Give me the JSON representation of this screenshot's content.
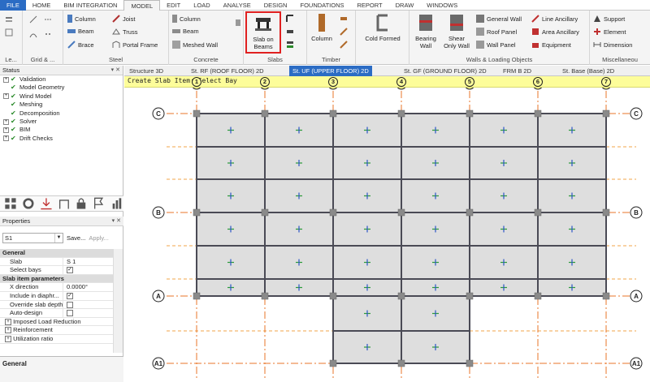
{
  "menu": {
    "tabs": [
      {
        "label": "FILE"
      },
      {
        "label": "HOME"
      },
      {
        "label": "BIM INTEGRATION"
      },
      {
        "label": "MODEL"
      },
      {
        "label": "EDIT"
      },
      {
        "label": "LOAD"
      },
      {
        "label": "ANALYSE"
      },
      {
        "label": "DESIGN"
      },
      {
        "label": "FOUNDATIONS"
      },
      {
        "label": "REPORT"
      },
      {
        "label": "DRAW"
      },
      {
        "label": "WINDOWS"
      }
    ]
  },
  "ribbon": {
    "groups": {
      "levels": "Le...",
      "grid": "Grid & ...",
      "steel": "Steel",
      "concrete": "Concrete",
      "slabs": "Slabs",
      "timber": "Timber",
      "walls": "Walls & Loading Objects",
      "misc": "Miscellaneou"
    },
    "steel": {
      "column": "Column",
      "beam": "Beam",
      "brace": "Brace",
      "joist": "Joist",
      "truss": "Truss",
      "portal_frame": "Portal Frame"
    },
    "concrete": {
      "column": "Column",
      "beam": "Beam",
      "meshed_wall": "Meshed Wall"
    },
    "slabs": {
      "slab_on_beams_1": "Slab on",
      "slab_on_beams_2": "Beams"
    },
    "timber": {
      "column": "Column"
    },
    "cold_formed": "Cold Formed",
    "walls": {
      "bearing_1": "Bearing",
      "bearing_2": "Wall",
      "shear_1": "Shear",
      "shear_2": "Only Wall",
      "general_wall": "General Wall",
      "roof_panel": "Roof Panel",
      "wall_panel": "Wall Panel",
      "line_ancillary": "Line Ancillary",
      "area_ancillary": "Area Ancillary",
      "equipment": "Equipment"
    },
    "misc": {
      "support": "Support",
      "element": "Element",
      "dimension": "Dimension"
    }
  },
  "status": {
    "title": "Status",
    "items": [
      {
        "label": "Validation",
        "expandable": true
      },
      {
        "label": "Model Geometry",
        "expandable": false
      },
      {
        "label": "Wind Model",
        "expandable": true
      },
      {
        "label": "Meshing",
        "expandable": false
      },
      {
        "label": "Decomposition",
        "expandable": false
      },
      {
        "label": "Solver",
        "expandable": true
      },
      {
        "label": "BIM",
        "expandable": true
      },
      {
        "label": "Drift Checks",
        "expandable": true
      }
    ]
  },
  "properties": {
    "title": "Properties",
    "selected": "S1",
    "save_label": "Save...",
    "apply_label": "Apply...",
    "general_cat": "General",
    "slab_key": "Slab",
    "slab_val": "S 1",
    "select_bays_key": "Select bays",
    "slab_params_cat": "Slab item parameters",
    "x_direction_key": "X direction",
    "x_direction_val": "0.0000°",
    "include_key": "Include in diaphr...",
    "override_key": "Override slab depth",
    "auto_design_key": "Auto-design",
    "imposed_key": "Imposed Load Reduction",
    "reinforcement_key": "Reinforcement",
    "utilization_key": "Utilization ratio",
    "footer": "General"
  },
  "doc_tabs": [
    {
      "label": "Structure 3D"
    },
    {
      "label": "St. RF (ROOF FLOOR) 2D"
    },
    {
      "label": "St. UF (UPPER FLOOR) 2D"
    },
    {
      "label": "St. GF (GROUND FLOOR) 2D"
    },
    {
      "label": "FRM B 2D"
    },
    {
      "label": "St. Base (Base) 2D"
    }
  ],
  "prompt": "Create Slab Item: Select Bay",
  "grid": {
    "col_labels": [
      "1",
      "2",
      "3",
      "4",
      "5",
      "6",
      "7"
    ],
    "row_labels": [
      "C",
      "B",
      "A",
      "A1"
    ]
  },
  "colors": {
    "accent": "#2b6cc4",
    "highlight": "#e02020",
    "prompt_bg": "#fdfd9a",
    "grid_line": "#e8762a",
    "beam": "#4a4a55",
    "slab_fill": "#dedede"
  }
}
